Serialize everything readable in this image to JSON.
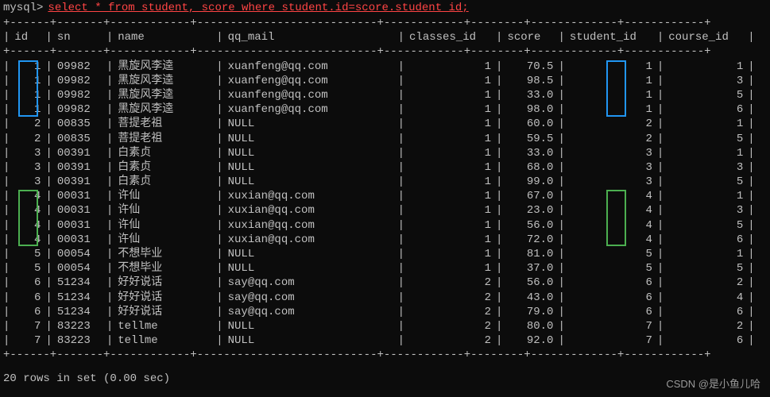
{
  "prompt": "mysql>",
  "query": "select * from student, score where student.id=score.student_id;",
  "headers": {
    "id": "id",
    "sn": "sn",
    "name": "name",
    "qq": "qq_mail",
    "classes": "classes_id",
    "score": "score",
    "student": "student_id",
    "course": "course_id"
  },
  "rows": [
    {
      "id": "1",
      "sn": "09982",
      "name": "黑旋风李逵",
      "qq": "xuanfeng@qq.com",
      "classes": "1",
      "score": "70.5",
      "student": "1",
      "course": "1"
    },
    {
      "id": "1",
      "sn": "09982",
      "name": "黑旋风李逵",
      "qq": "xuanfeng@qq.com",
      "classes": "1",
      "score": "98.5",
      "student": "1",
      "course": "3"
    },
    {
      "id": "1",
      "sn": "09982",
      "name": "黑旋风李逵",
      "qq": "xuanfeng@qq.com",
      "classes": "1",
      "score": "33.0",
      "student": "1",
      "course": "5"
    },
    {
      "id": "1",
      "sn": "09982",
      "name": "黑旋风李逵",
      "qq": "xuanfeng@qq.com",
      "classes": "1",
      "score": "98.0",
      "student": "1",
      "course": "6"
    },
    {
      "id": "2",
      "sn": "00835",
      "name": "菩提老祖",
      "qq": "NULL",
      "classes": "1",
      "score": "60.0",
      "student": "2",
      "course": "1"
    },
    {
      "id": "2",
      "sn": "00835",
      "name": "菩提老祖",
      "qq": "NULL",
      "classes": "1",
      "score": "59.5",
      "student": "2",
      "course": "5"
    },
    {
      "id": "3",
      "sn": "00391",
      "name": "白素贞",
      "qq": "NULL",
      "classes": "1",
      "score": "33.0",
      "student": "3",
      "course": "1"
    },
    {
      "id": "3",
      "sn": "00391",
      "name": "白素贞",
      "qq": "NULL",
      "classes": "1",
      "score": "68.0",
      "student": "3",
      "course": "3"
    },
    {
      "id": "3",
      "sn": "00391",
      "name": "白素贞",
      "qq": "NULL",
      "classes": "1",
      "score": "99.0",
      "student": "3",
      "course": "5"
    },
    {
      "id": "4",
      "sn": "00031",
      "name": "许仙",
      "qq": "xuxian@qq.com",
      "classes": "1",
      "score": "67.0",
      "student": "4",
      "course": "1"
    },
    {
      "id": "4",
      "sn": "00031",
      "name": "许仙",
      "qq": "xuxian@qq.com",
      "classes": "1",
      "score": "23.0",
      "student": "4",
      "course": "3"
    },
    {
      "id": "4",
      "sn": "00031",
      "name": "许仙",
      "qq": "xuxian@qq.com",
      "classes": "1",
      "score": "56.0",
      "student": "4",
      "course": "5"
    },
    {
      "id": "4",
      "sn": "00031",
      "name": "许仙",
      "qq": "xuxian@qq.com",
      "classes": "1",
      "score": "72.0",
      "student": "4",
      "course": "6"
    },
    {
      "id": "5",
      "sn": "00054",
      "name": "不想毕业",
      "qq": "NULL",
      "classes": "1",
      "score": "81.0",
      "student": "5",
      "course": "1"
    },
    {
      "id": "5",
      "sn": "00054",
      "name": "不想毕业",
      "qq": "NULL",
      "classes": "1",
      "score": "37.0",
      "student": "5",
      "course": "5"
    },
    {
      "id": "6",
      "sn": "51234",
      "name": "好好说话",
      "qq": "say@qq.com",
      "classes": "2",
      "score": "56.0",
      "student": "6",
      "course": "2"
    },
    {
      "id": "6",
      "sn": "51234",
      "name": "好好说话",
      "qq": "say@qq.com",
      "classes": "2",
      "score": "43.0",
      "student": "6",
      "course": "4"
    },
    {
      "id": "6",
      "sn": "51234",
      "name": "好好说话",
      "qq": "say@qq.com",
      "classes": "2",
      "score": "79.0",
      "student": "6",
      "course": "6"
    },
    {
      "id": "7",
      "sn": "83223",
      "name": "tellme",
      "qq": "NULL",
      "classes": "2",
      "score": "80.0",
      "student": "7",
      "course": "2"
    },
    {
      "id": "7",
      "sn": "83223",
      "name": "tellme",
      "qq": "NULL",
      "classes": "2",
      "score": "92.0",
      "student": "7",
      "course": "6"
    }
  ],
  "sep": "+------+-------+------------+---------------------------+------------+--------+-------------+------------+",
  "footer": "20 rows in set (0.00 sec)",
  "watermark": "CSDN @是小鱼儿哈"
}
